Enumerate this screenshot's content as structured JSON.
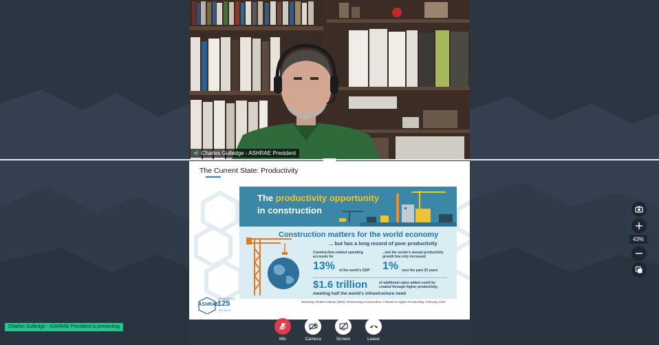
{
  "speaker": {
    "name_tag": "Charles Gulledge - ASHRAE President"
  },
  "slide": {
    "title": "The Current State: Productivity",
    "infographic": {
      "headline_pre": "The ",
      "headline_highlight": "productivity opportunity",
      "headline_line2": "in construction",
      "section_heading": "Construction matters for the world economy",
      "section_subheading": "... but has a long record of poor productivity",
      "left_caption_line1": "Construction-related spending",
      "left_caption_line2": "accounts for",
      "left_stat": "13%",
      "left_stat_suffix": "of the world's GDP",
      "right_caption_line1": "...but the sector's annual productivity",
      "right_caption_line2": "growth has only increased",
      "right_stat": "1%",
      "right_stat_suffix": "over the past 20 years",
      "bottom_stat": "$1.6 trillion",
      "bottom_caption_line1": "of additional value added could be",
      "bottom_caption_line2": "created through higher productivity,",
      "bottom_caption_line3": "meeting half the world's infrastructure need",
      "citation": "McKinsey Global Institute (MGI), Reinventing Construction:  A Route to Higher Productivity, February 2107"
    },
    "logo": {
      "wordmark": "ASHRAE",
      "celebrating": "CELEBRATING",
      "number": "125",
      "years": "YEARS"
    }
  },
  "tools": {
    "zoom_level": "43%",
    "icons": [
      "camera-icon",
      "zoom-in-icon",
      "zoom-out-icon",
      "copy-icon"
    ]
  },
  "status": {
    "presenting": "Charles Gulledge - ASHRAE President is presenting"
  },
  "controls": [
    {
      "label": "Mic",
      "icon": "mic-off-icon"
    },
    {
      "label": "Camera",
      "icon": "camera-off-icon"
    },
    {
      "label": "Screen",
      "icon": "screen-share-icon"
    },
    {
      "label": "Leave",
      "icon": "phone-hangup-icon"
    }
  ],
  "colors": {
    "background": "#2c3542",
    "presenting_badge": "#22c58e",
    "mic_muted": "#e03b4c",
    "infographic_accent": "#1a7fb5",
    "headline_highlight": "#f5c518"
  }
}
